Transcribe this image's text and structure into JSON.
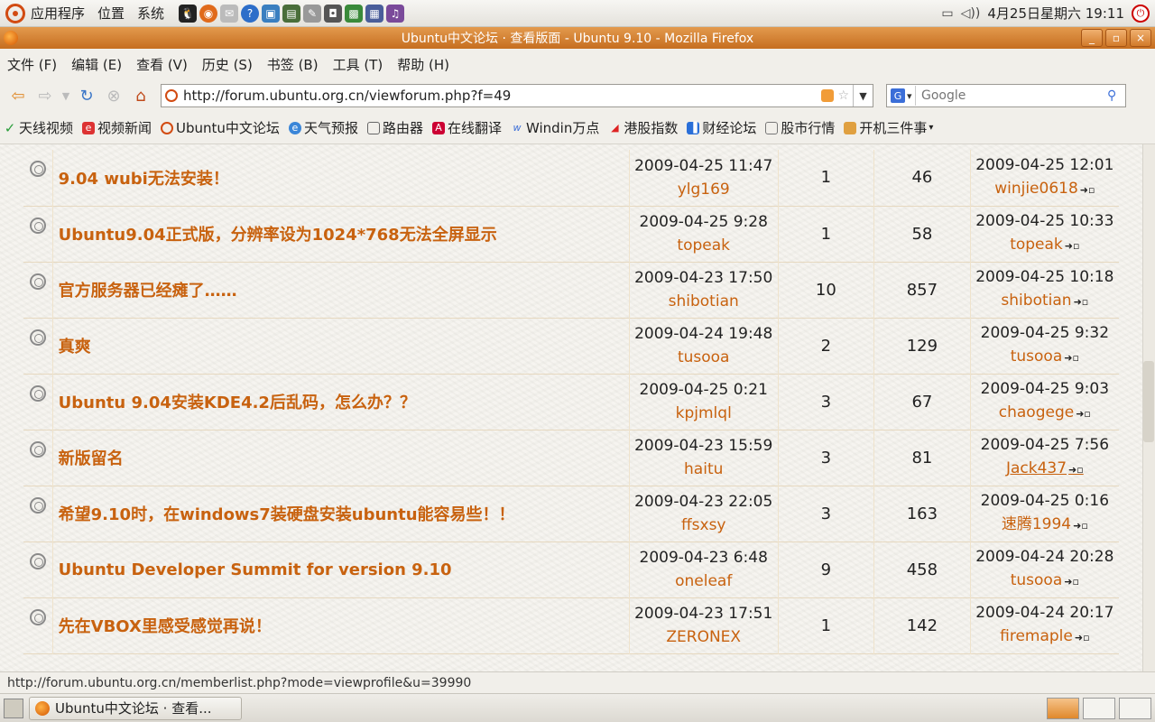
{
  "panel": {
    "menus": [
      "应用程序",
      "位置",
      "系统"
    ],
    "clock": "4月25日星期六 19:11"
  },
  "window": {
    "title": "Ubuntu中文论坛 · 查看版面 - Ubuntu 9.10 - Mozilla Firefox",
    "buttons": [
      "_",
      "▫",
      "×"
    ]
  },
  "menubar": [
    "文件 (F)",
    "编辑 (E)",
    "查看 (V)",
    "历史 (S)",
    "书签 (B)",
    "工具 (T)",
    "帮助 (H)"
  ],
  "nav": {
    "url": "http://forum.ubuntu.org.cn/viewforum.php?f=49",
    "search_placeholder": "Google"
  },
  "bookmarks": [
    {
      "label": "天线视频",
      "icon": "v-icon",
      "color": "#2a9d3a"
    },
    {
      "label": "视频新闻",
      "icon": "news-icon",
      "color": "#d33"
    },
    {
      "label": "Ubuntu中文论坛",
      "icon": "ubuntu-icon",
      "color": "#d24b12"
    },
    {
      "label": "天气预报",
      "icon": "weather-icon",
      "color": "#3b86d8"
    },
    {
      "label": "路由器",
      "icon": "router-icon",
      "color": "#666"
    },
    {
      "label": "在线翻译",
      "icon": "translate-icon",
      "color": "#c03"
    },
    {
      "label": "Windin万点",
      "icon": "w-icon",
      "color": "#3b6ed8"
    },
    {
      "label": "港股指数",
      "icon": "stock-icon",
      "color": "#d22"
    },
    {
      "label": "财经论坛",
      "icon": "forum-icon",
      "color": "#2a6fd8"
    },
    {
      "label": "股市行情",
      "icon": "market-icon",
      "color": "#777"
    },
    {
      "label": "开机三件事",
      "icon": "folder-icon",
      "color": "#e0a040"
    }
  ],
  "topics": [
    {
      "title": "9.04 wubi无法安装！",
      "date": "2009-04-25 11:47",
      "author": "ylg169",
      "replies": "1",
      "views": "46",
      "last_date": "2009-04-25 12:01",
      "last_user": "winjie0618"
    },
    {
      "title": "Ubuntu9.04正式版，分辨率设为1024*768无法全屏显示",
      "date": "2009-04-25 9:28",
      "author": "topeak",
      "replies": "1",
      "views": "58",
      "last_date": "2009-04-25 10:33",
      "last_user": "topeak"
    },
    {
      "title": "官方服务器已经瘫了……",
      "date": "2009-04-23 17:50",
      "author": "shibotian",
      "replies": "10",
      "views": "857",
      "last_date": "2009-04-25 10:18",
      "last_user": "shibotian"
    },
    {
      "title": "真爽",
      "date": "2009-04-24 19:48",
      "author": "tusooa",
      "replies": "2",
      "views": "129",
      "last_date": "2009-04-25 9:32",
      "last_user": "tusooa"
    },
    {
      "title": "Ubuntu 9.04安装KDE4.2后乱码，怎么办？？",
      "date": "2009-04-25 0:21",
      "author": "kpjmlql",
      "replies": "3",
      "views": "67",
      "last_date": "2009-04-25 9:03",
      "last_user": "chaogege"
    },
    {
      "title": "新版留名",
      "date": "2009-04-23 15:59",
      "author": "haitu",
      "replies": "3",
      "views": "81",
      "last_date": "2009-04-25 7:56",
      "last_user": "Jack437"
    },
    {
      "title": "希望9.10时，在windows7装硬盘安装ubuntu能容易些！！",
      "date": "2009-04-23 22:05",
      "author": "ffsxsy",
      "replies": "3",
      "views": "163",
      "last_date": "2009-04-25 0:16",
      "last_user": "速腾1994"
    },
    {
      "title": "Ubuntu Developer Summit for version 9.10",
      "date": "2009-04-23 6:48",
      "author": "oneleaf",
      "replies": "9",
      "views": "458",
      "last_date": "2009-04-24 20:28",
      "last_user": "tusooa"
    },
    {
      "title": "先在VBOX里感受感觉再说！",
      "date": "2009-04-23 17:51",
      "author": "ZERONEX",
      "replies": "1",
      "views": "142",
      "last_date": "2009-04-24 20:17",
      "last_user": "firemaple"
    }
  ],
  "status": "http://forum.ubuntu.org.cn/memberlist.php?mode=viewprofile&u=39990",
  "taskbar": {
    "task_label": "Ubuntu中文论坛 · 查看..."
  }
}
